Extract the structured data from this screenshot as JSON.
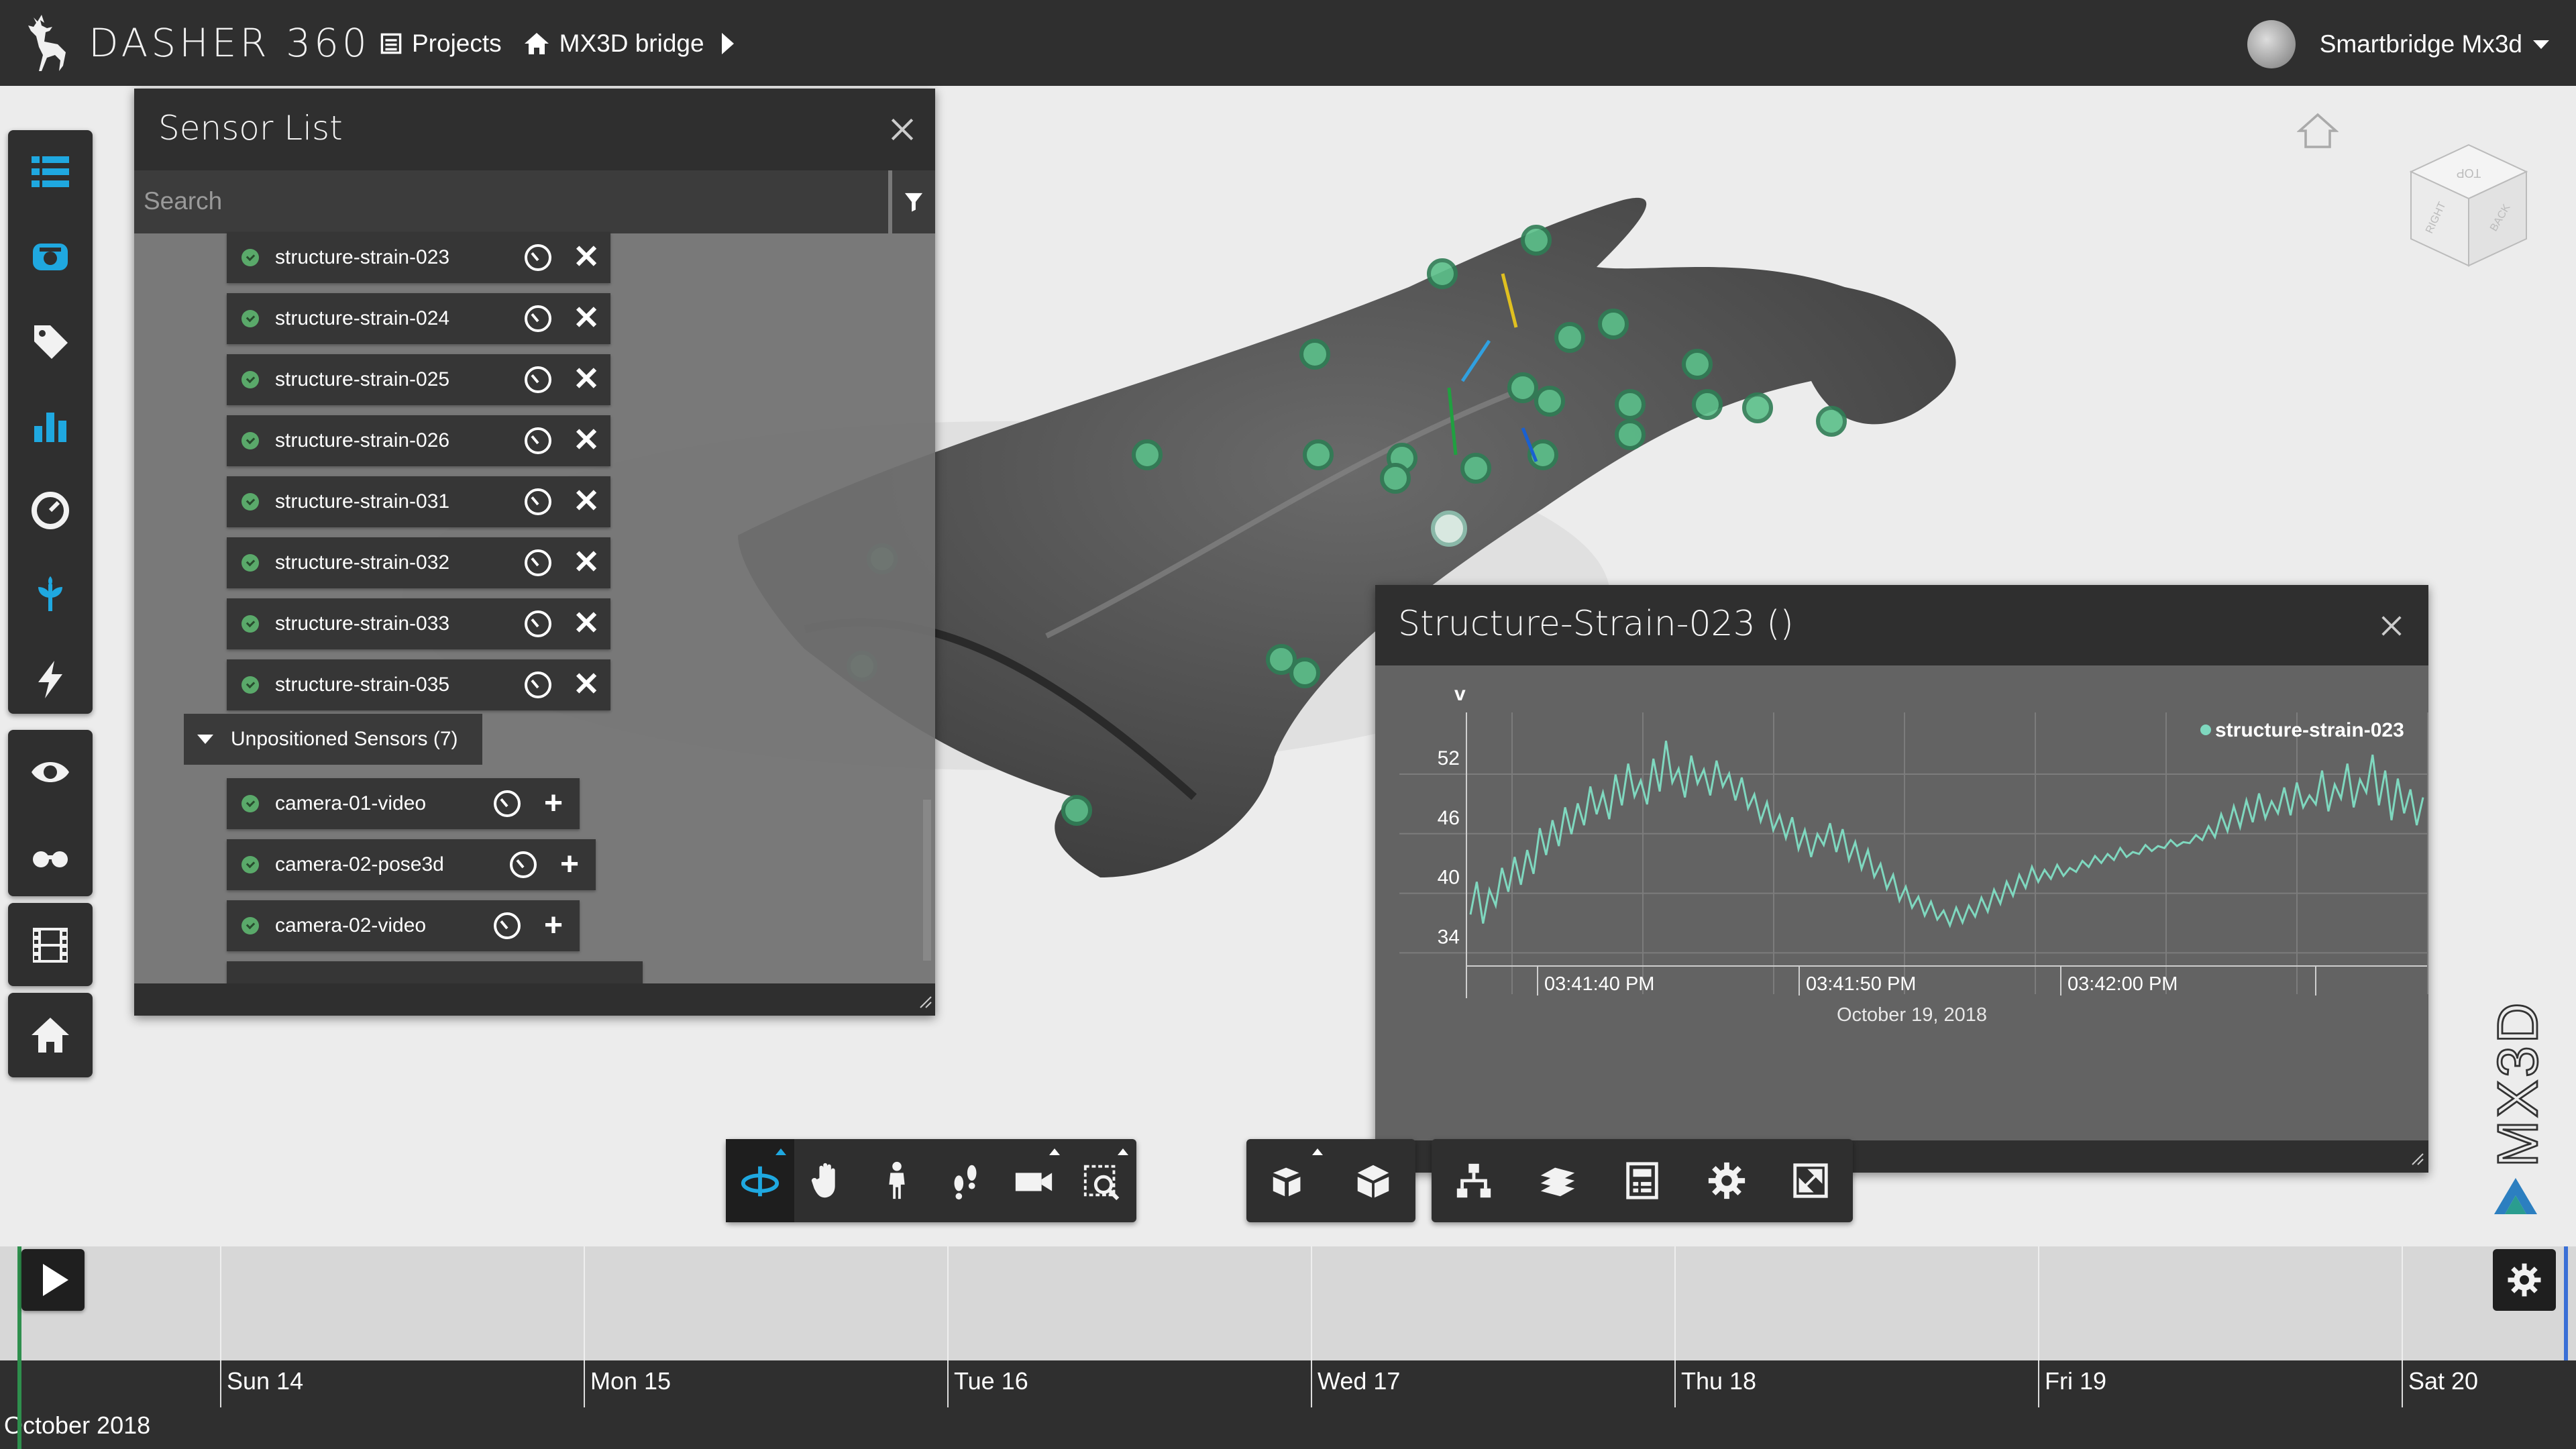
{
  "app": {
    "title": "DASHER 360",
    "breadcrumbs": {
      "projects": "Projects",
      "project": "MX3D bridge"
    },
    "user": "Smartbridge Mx3d"
  },
  "left_toolbar": {
    "icons": [
      "list-icon",
      "sensor-cam-icon",
      "tag-icon",
      "bar-chart-icon",
      "gauge-icon",
      "plant-icon",
      "lightning-icon",
      "eye-icon",
      "glasses-icon",
      "film-icon",
      "home-icon"
    ]
  },
  "sensor_list": {
    "title": "Sensor List",
    "search_placeholder": "Search",
    "positioned": [
      "structure-strain-023",
      "structure-strain-024",
      "structure-strain-025",
      "structure-strain-026",
      "structure-strain-031",
      "structure-strain-032",
      "structure-strain-033",
      "structure-strain-035"
    ],
    "unpositioned_group": "Unpositioned Sensors (7)",
    "unpositioned": [
      "camera-01-video",
      "camera-02-pose3d",
      "camera-02-video"
    ]
  },
  "chart_panel": {
    "title": "Structure-Strain-023 ()",
    "date_label": "October 19, 2018"
  },
  "chart_data": {
    "type": "line",
    "ylabel": "v",
    "ylim": [
      32,
      57
    ],
    "yticks": [
      "52",
      "46",
      "40",
      "34"
    ],
    "yticks_values": [
      52,
      46,
      40,
      34
    ],
    "xticks": [
      "03:41:40 PM",
      "03:41:50 PM",
      "03:42:00 PM"
    ],
    "xlabel": "October 19, 2018",
    "legend_position": "top-right",
    "color": "#7fd8bf",
    "series": [
      {
        "name": "structure-strain-023",
        "values": [
          36.1,
          39.4,
          35.2,
          38.6,
          37.0,
          40.8,
          38.4,
          41.9,
          39.1,
          42.6,
          40.2,
          44.8,
          42.1,
          45.6,
          43.0,
          46.9,
          44.2,
          47.3,
          45.1,
          49.0,
          46.2,
          48.4,
          45.7,
          50.2,
          47.1,
          51.3,
          48.0,
          49.6,
          47.2,
          51.8,
          48.5,
          53.6,
          49.4,
          50.8,
          47.9,
          52.1,
          49.3,
          50.7,
          48.1,
          51.6,
          49.0,
          50.3,
          47.6,
          49.9,
          46.8,
          48.2,
          45.5,
          47.4,
          44.6,
          46.1,
          43.8,
          45.9,
          42.7,
          44.6,
          41.9,
          44.2,
          43.1,
          45.3,
          42.4,
          44.7,
          41.6,
          43.4,
          40.7,
          42.6,
          39.9,
          41.2,
          38.7,
          40.1,
          37.5,
          38.9,
          36.8,
          37.9,
          36.0,
          37.4,
          35.6,
          36.5,
          35.0,
          36.8,
          35.3,
          37.0,
          35.9,
          37.8,
          36.4,
          38.6,
          37.2,
          39.4,
          38.0,
          40.1,
          38.8,
          40.9,
          39.4,
          40.6,
          39.7,
          41.1,
          40.0,
          40.8,
          40.4,
          41.5,
          40.9,
          42.0,
          41.3,
          42.2,
          41.6,
          42.8,
          41.9,
          42.4,
          42.2,
          43.1,
          42.5,
          43.0,
          42.8,
          43.6,
          43.0,
          43.4,
          43.3,
          44.1,
          43.6,
          45.0,
          43.9,
          46.2,
          44.5,
          47.0,
          44.9,
          47.6,
          45.4,
          48.3,
          45.8,
          47.5,
          46.3,
          48.9,
          46.1,
          49.4,
          46.9,
          48.1,
          47.2,
          50.6,
          46.5,
          49.2,
          47.8,
          51.3,
          46.9,
          49.7,
          48.4,
          52.2,
          47.1,
          50.6,
          45.6,
          49.8,
          46.3,
          48.7,
          45.1,
          47.9
        ]
      }
    ]
  },
  "bottom_toolbar": {
    "navigate": [
      "orbit-icon",
      "pan-icon",
      "person-icon",
      "footsteps-icon",
      "camera-icon",
      "zoom-window-icon"
    ],
    "model": [
      "explode-icon",
      "cube-icon"
    ],
    "settings": [
      "model-browser-icon",
      "layers-icon",
      "properties-icon",
      "settings-icon",
      "fullscreen-icon"
    ]
  },
  "timeline": {
    "days": [
      "Sun 14",
      "Mon 15",
      "Tue 16",
      "Wed 17",
      "Thu 18",
      "Fri 19",
      "Sat 20"
    ],
    "month": "October 2018"
  },
  "colors": {
    "topbar": "#2f2f2f",
    "accent_blue": "#1fa8e0",
    "sensor_green": "#5aa96a",
    "series": "#7fd8bf",
    "autodesk_blue": "#2c7fc0",
    "autodesk_green": "#2a9d8f"
  }
}
